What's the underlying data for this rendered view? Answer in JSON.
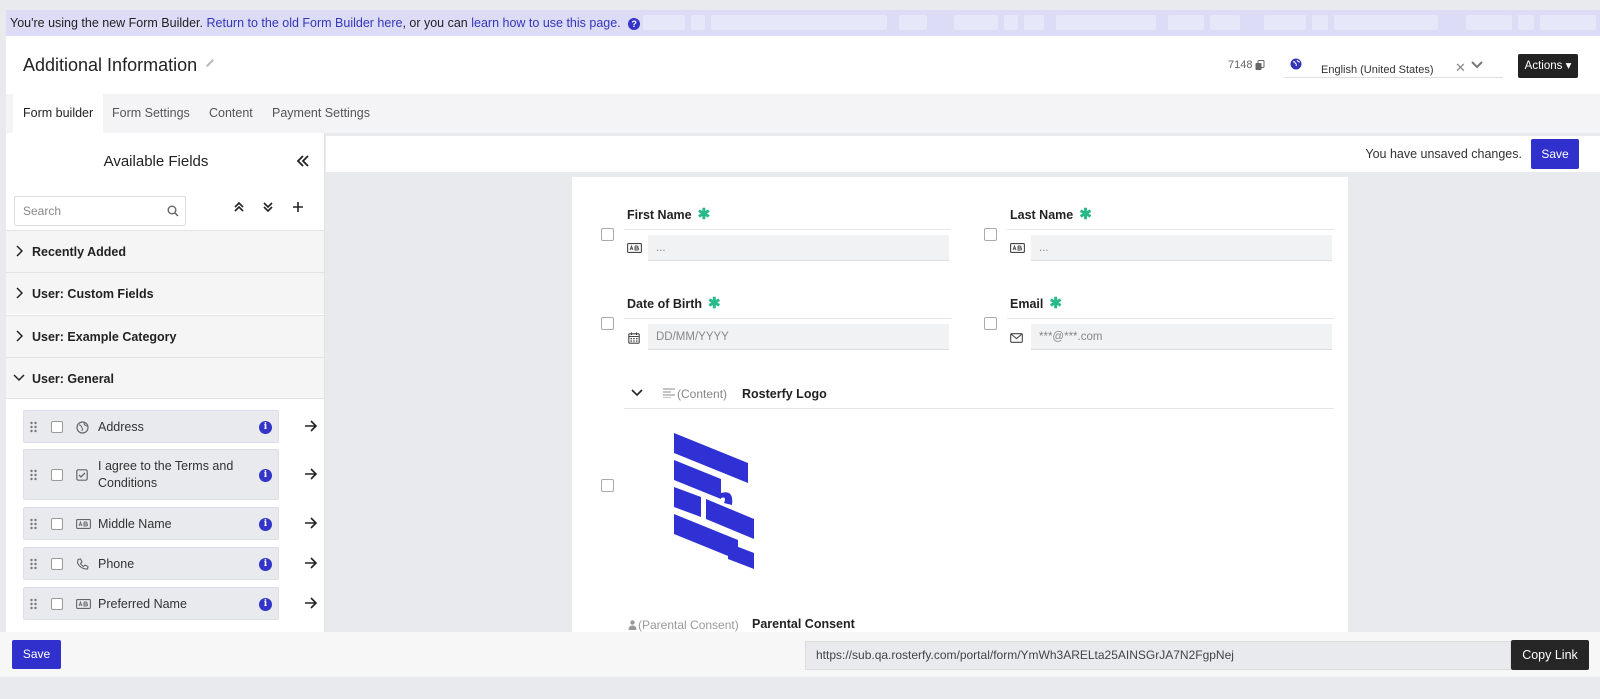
{
  "banner": {
    "text_prefix": "You're using the new Form Builder.",
    "link_return": "Return to the old Form Builder here",
    "text_middle": ", or you can",
    "link_learn": "learn how to use this page.",
    "help_glyph": "?"
  },
  "header": {
    "title": "Additional Information",
    "form_id": "7148",
    "language": "English (United States)",
    "clear_glyph": "✕",
    "actions_label": "Actions ▾"
  },
  "tabs": [
    {
      "label": "Form builder",
      "active": true
    },
    {
      "label": "Form Settings",
      "active": false
    },
    {
      "label": "Content",
      "active": false
    },
    {
      "label": "Payment Settings",
      "active": false
    }
  ],
  "sidebar": {
    "title": "Available Fields",
    "search_placeholder": "Search",
    "categories": [
      {
        "label": "Recently Added",
        "expanded": false
      },
      {
        "label": "User: Custom Fields",
        "expanded": false
      },
      {
        "label": "User: Example Category",
        "expanded": false
      },
      {
        "label": "User: General",
        "expanded": true
      }
    ],
    "fields": [
      {
        "label": "Address",
        "icon": "globe-icon"
      },
      {
        "label": "I agree to the Terms and Conditions",
        "icon": "checkbox-icon"
      },
      {
        "label": "Middle Name",
        "icon": "text-field-icon"
      },
      {
        "label": "Phone",
        "icon": "phone-icon"
      },
      {
        "label": "Preferred Name",
        "icon": "text-field-icon"
      }
    ],
    "info_glyph": "i"
  },
  "toolbar": {
    "unsaved_text": "You have unsaved changes.",
    "save_label": "Save"
  },
  "form": {
    "first_name": {
      "label": "First Name",
      "placeholder": "..."
    },
    "last_name": {
      "label": "Last Name",
      "placeholder": "..."
    },
    "date_of_birth": {
      "label": "Date of Birth",
      "placeholder": "DD/MM/YYYY"
    },
    "email": {
      "label": "Email",
      "placeholder": "***@***.com"
    },
    "required_glyph": "✱",
    "content_block": {
      "type_label": "(Content)",
      "name": "Rosterfy Logo"
    },
    "consent_block": {
      "type_label": "(Parental Consent)",
      "name": "Parental Consent"
    }
  },
  "footer": {
    "save_label": "Save",
    "link_url": "https://sub.qa.rosterfy.com/portal/form/YmWh3ARELta25AINSGrJA7N2FgpNej",
    "copy_label": "Copy Link"
  },
  "colors": {
    "accent": "#3030cc",
    "required": "#28b98a",
    "banner": "#dcdcf7"
  }
}
